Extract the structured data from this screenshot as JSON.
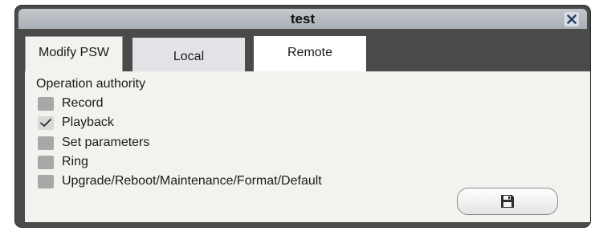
{
  "window": {
    "title": "test"
  },
  "tabs": [
    {
      "label": "Modify PSW",
      "active": true
    },
    {
      "label": "Local",
      "active": false
    },
    {
      "label": "Remote",
      "active": false
    }
  ],
  "permissions": {
    "heading": "Operation authority",
    "items": [
      {
        "label": "Record",
        "checked": false
      },
      {
        "label": "Playback",
        "checked": true
      },
      {
        "label": "Set parameters",
        "checked": false
      },
      {
        "label": "Ring",
        "checked": false
      },
      {
        "label": "Upgrade/Reboot/Maintenance/Format/Default",
        "checked": false
      }
    ]
  },
  "icons": {
    "close": "close-icon",
    "save": "floppy-disk-icon",
    "check": "checkmark-icon"
  },
  "colors": {
    "frame": "#4a4a4a",
    "titlebar": "#b5bbc1",
    "content": "#f2f2ee",
    "checkbox": "#a8a8a8"
  }
}
